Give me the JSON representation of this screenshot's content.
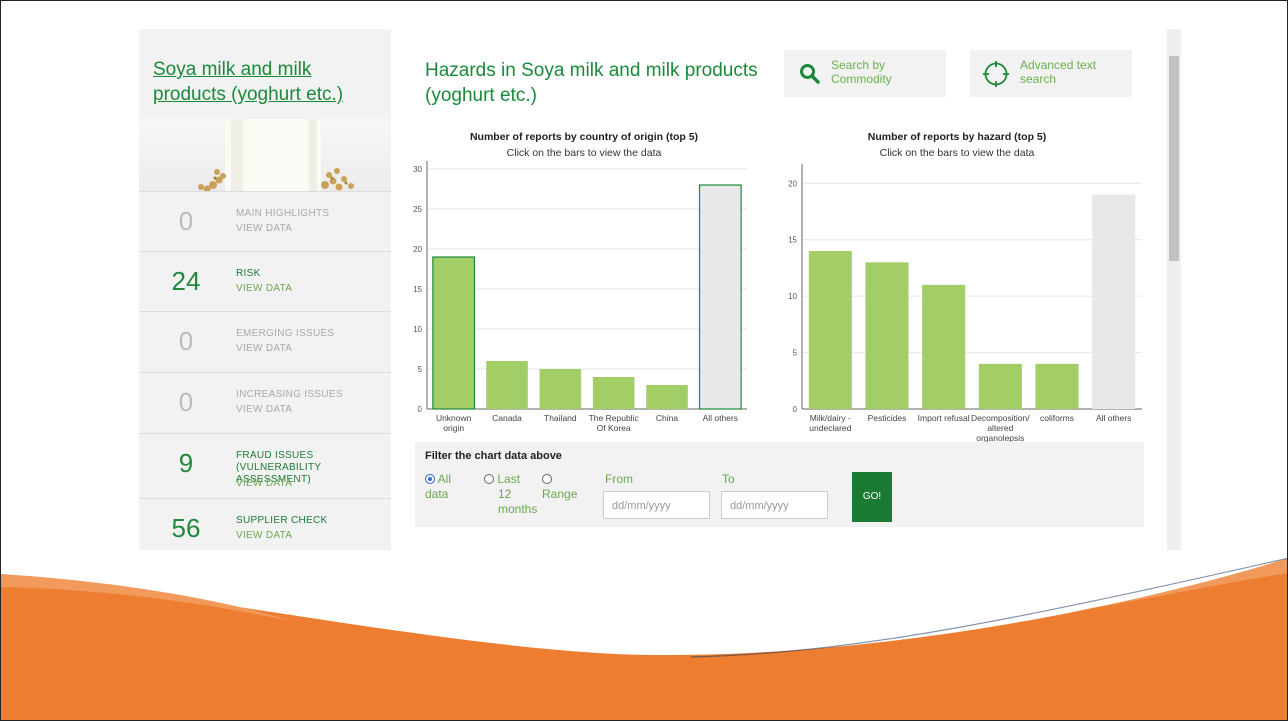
{
  "sidebar": {
    "commodity_title": "Soya milk and milk products (yoghurt etc.)",
    "view_label": "VIEW DATA",
    "metrics": [
      {
        "count": "0",
        "label_lines": [
          "MAIN HIGHLIGHTS"
        ],
        "active": false
      },
      {
        "count": "24",
        "label_lines": [
          "RISK"
        ],
        "active": true
      },
      {
        "count": "0",
        "label_lines": [
          "EMERGING ISSUES"
        ],
        "active": false
      },
      {
        "count": "0",
        "label_lines": [
          "INCREASING ISSUES"
        ],
        "active": false
      },
      {
        "count": "9",
        "label_lines": [
          "FRAUD ISSUES",
          "(VULNERABILITY ASSESSMENT)"
        ],
        "active": true
      },
      {
        "count": "56",
        "label_lines": [
          "SUPPLIER CHECK"
        ],
        "active": true
      }
    ]
  },
  "main": {
    "title": "Hazards in Soya milk and milk products (yoghurt etc.)",
    "search_commodity": {
      "line1": "Search by",
      "line2": "Commodity",
      "icon": "search-icon"
    },
    "advanced_search": {
      "line1": "Advanced text",
      "line2": "search",
      "icon": "crosshair-icon"
    }
  },
  "chart_data": [
    {
      "type": "bar",
      "title": "Number of reports by country of origin (top 5)",
      "subtitle": "Click on the bars to view the data",
      "categories": [
        [
          "Unknown",
          "origin"
        ],
        [
          "Canada"
        ],
        [
          "Thailand"
        ],
        [
          "The Republic",
          "Of Korea"
        ],
        [
          "China"
        ],
        [
          "All others"
        ]
      ],
      "values": [
        19,
        6,
        5,
        4,
        3,
        28
      ],
      "ylim": [
        0,
        30
      ],
      "yticks": [
        0,
        5,
        10,
        15,
        20,
        25,
        30
      ],
      "grid": true,
      "bar_color": "#a3cd67",
      "others_color": "#e8e8e8",
      "highlight_stroke": "#1a8a3a"
    },
    {
      "type": "bar",
      "title": "Number of reports by hazard (top 5)",
      "subtitle": "Click on the bars to view the data",
      "categories": [
        [
          "Milk/dairy -",
          "undeclared"
        ],
        [
          "Pesticides"
        ],
        [
          "Import refusal"
        ],
        [
          "Decomposition/",
          "altered",
          "organolepsis"
        ],
        [
          "coliforms"
        ],
        [
          "All others"
        ]
      ],
      "values": [
        14,
        13,
        11,
        4,
        4,
        19
      ],
      "ylim": [
        0,
        21
      ],
      "yticks": [
        0,
        5,
        10,
        15,
        20
      ],
      "grid": true,
      "bar_color": "#a3cd67",
      "others_color": "#e8e8e8"
    }
  ],
  "filter": {
    "title": "Filter the chart data above",
    "option_all": [
      "All",
      "data"
    ],
    "option_last": [
      "Last",
      "12",
      "months"
    ],
    "option_range": [
      "",
      "Range"
    ],
    "from_label": "From",
    "to_label": "To",
    "date_placeholder": "dd/mm/yyyy",
    "go_label": "GO!"
  },
  "theme": {
    "brand_green": "#1a8a3a",
    "accent_orange": "#ed7d31"
  }
}
